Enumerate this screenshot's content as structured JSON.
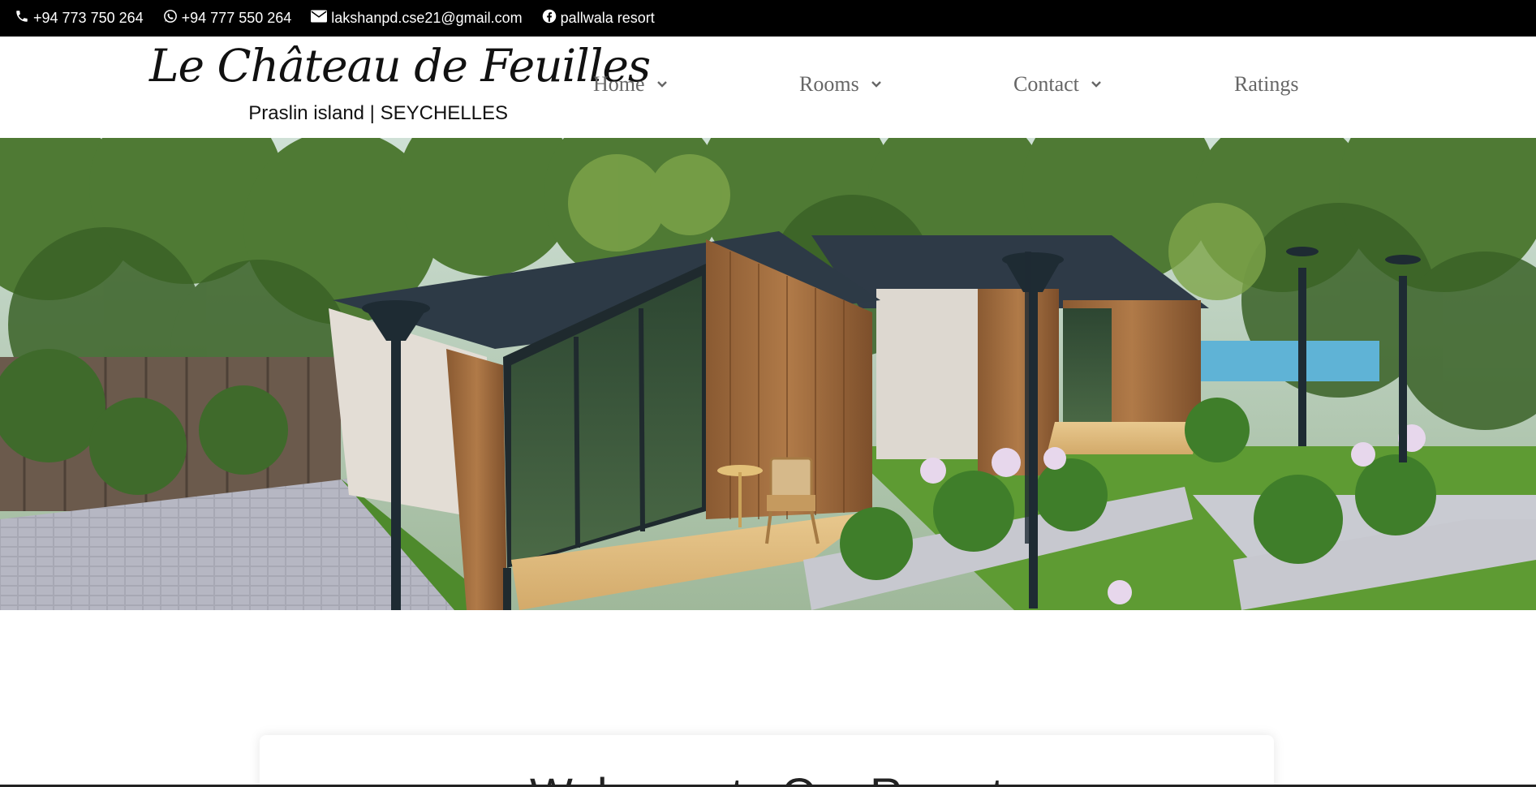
{
  "topbar": {
    "phone": "+94 773 750 264",
    "whatsapp": "+94 777 550 264",
    "email": "lakshanpd.cse21@gmail.com",
    "facebook": "pallwala resort"
  },
  "logo": {
    "title": "Le Château de Feuilles",
    "subtitle": "Praslin island | SEYCHELLES"
  },
  "nav": {
    "items": [
      {
        "label": "Home",
        "has_dropdown": true
      },
      {
        "label": "Rooms",
        "has_dropdown": true
      },
      {
        "label": "Contact",
        "has_dropdown": true
      },
      {
        "label": "Ratings",
        "has_dropdown": false
      }
    ]
  },
  "welcome": {
    "heading": "Welcome to Our Resort"
  },
  "icons": [
    "phone-icon",
    "whatsapp-icon",
    "envelope-icon",
    "facebook-icon",
    "chevron-down-icon"
  ],
  "colors": {
    "topbar_bg": "#000000",
    "nav_text": "#666666"
  }
}
